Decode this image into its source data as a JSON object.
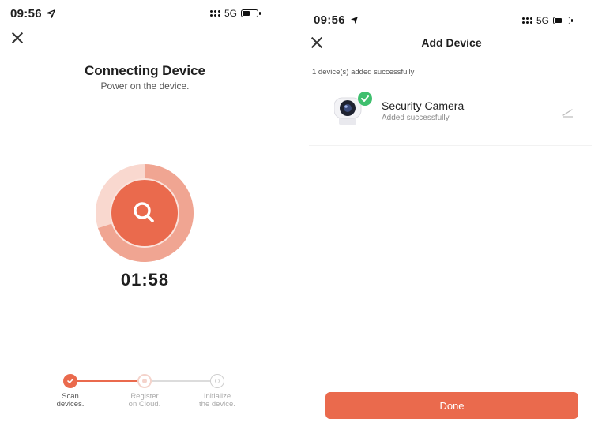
{
  "left": {
    "status_time": "09:56",
    "network": "5G",
    "title": "Connecting Device",
    "subtitle": "Power on the device.",
    "timer": "01:58",
    "progress_ring_fraction": 0.7,
    "steps": [
      {
        "label_line1": "Scan",
        "label_line2": "devices.",
        "state": "done"
      },
      {
        "label_line1": "Register",
        "label_line2": "on Cloud.",
        "state": "pending"
      },
      {
        "label_line1": "Initialize",
        "label_line2": "the device.",
        "state": "pending"
      }
    ]
  },
  "right": {
    "status_time": "09:56",
    "network": "5G",
    "title": "Add Device",
    "added_message": "1 device(s) added successfully",
    "device": {
      "name": "Security Camera",
      "status": "Added successfully"
    },
    "done_label": "Done"
  },
  "colors": {
    "accent": "#ea6a4d",
    "accent_light": "#f6c3b5",
    "success": "#3fbf6e"
  },
  "icons": {
    "close": "close-icon",
    "search": "search-icon",
    "check": "check-icon",
    "edit": "pencil-icon",
    "camera": "camera-icon",
    "location": "location-arrow-icon"
  }
}
